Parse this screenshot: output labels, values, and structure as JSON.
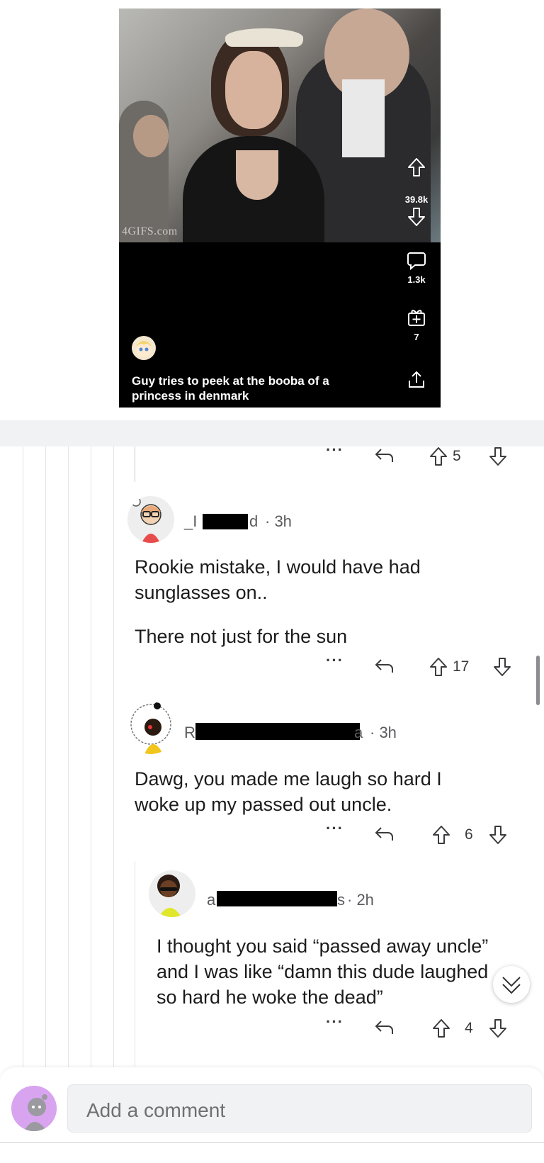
{
  "post": {
    "watermark": "4GIFS.com",
    "upvotes": "39.8k",
    "comments_count": "1.3k",
    "awards_count": "7",
    "caption": "Guy tries to peek at the booba of a princess in denmark"
  },
  "comments": [
    {
      "votes": "5"
    },
    {
      "username_start": "_I",
      "username_end": "d",
      "time": "· 3h",
      "body1": "Rookie mistake, I would have had sunglasses on..",
      "body2": "There not just for the sun",
      "votes": "17"
    },
    {
      "username_start": "R",
      "username_end": "a",
      "time": "· 3h",
      "body1": "Dawg, you made me laugh so hard I woke up my passed out uncle.",
      "votes": "6"
    },
    {
      "username_start": "a",
      "username_end": "s",
      "time": "· 2h",
      "body1": "I thought you said “passed away uncle” and I was like “damn this dude laughed so hard he woke the dead”",
      "votes": "4"
    }
  ],
  "composer": {
    "placeholder": "Add a comment"
  },
  "icons": [
    "upvote-icon",
    "downvote-icon",
    "comment-icon",
    "award-icon",
    "share-icon",
    "reply-icon",
    "more-icon",
    "chevron-down-icon"
  ]
}
